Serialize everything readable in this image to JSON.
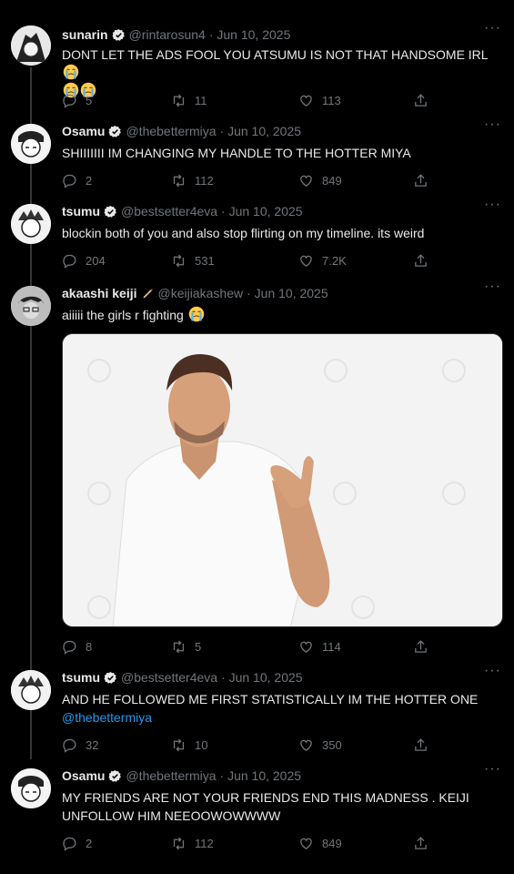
{
  "tweets": [
    {
      "name": "sunarin",
      "handle": "@rintarosun4",
      "date": "· Jun 10, 2025",
      "text": "DONT LET THE ADS FOOL YOU ATSUMU IS NOT THAT HANDSOME IRL",
      "replies": "5",
      "retweets": "11",
      "likes": "113",
      "verified": true
    },
    {
      "name": "Osamu",
      "handle": "@thebettermiya",
      "date": "· Jun 10, 2025",
      "text": "SHIIIIIII IM CHANGING MY HANDLE TO THE HOTTER MIYA",
      "replies": "2",
      "retweets": "112",
      "likes": "849",
      "verified": true
    },
    {
      "name": "tsumu",
      "handle": "@bestsetter4eva",
      "date": "· Jun 10, 2025",
      "text": "blockin both of you and also stop flirting on my timeline. its weird",
      "replies": "204",
      "retweets": "531",
      "likes": "7.2K",
      "verified": true
    },
    {
      "name": "akaashi keiji",
      "handle": "@keijiakashew",
      "date": "· Jun 10, 2025",
      "text": "aiiiii the girls r fighting",
      "replies": "8",
      "retweets": "5",
      "likes": "114",
      "verified": false
    },
    {
      "name": "tsumu",
      "handle": "@bestsetter4eva",
      "date": "· Jun 10, 2025",
      "text": "AND HE FOLLOWED ME FIRST STATISTICALLY IM THE HOTTER ONE",
      "link": "@thebettermiya",
      "replies": "32",
      "retweets": "10",
      "likes": "350",
      "verified": true
    },
    {
      "name": "Osamu",
      "handle": "@thebettermiya",
      "date": "· Jun 10, 2025",
      "text_line1": "MY FRIENDS ARE NOT YOUR FRIENDS END THIS MADNESS . KEIJI",
      "text_line2": "UNFOLLOW HIM NEEOOWOWWWW",
      "replies": "2",
      "retweets": "112",
      "likes": "849",
      "verified": true
    }
  ],
  "more_label": "···",
  "icons": {
    "reply": "reply-icon",
    "retweet": "retweet-icon",
    "like": "heart-icon",
    "share": "share-icon",
    "verified": "verified-badge-icon",
    "emoji": "loudly-crying-face-emoji",
    "pen": "pen-icon"
  },
  "colors": {
    "background": "#000000",
    "text": "#e7e9ea",
    "muted": "#71767b",
    "link": "#1d9bf0",
    "verified": "#ffffff"
  }
}
